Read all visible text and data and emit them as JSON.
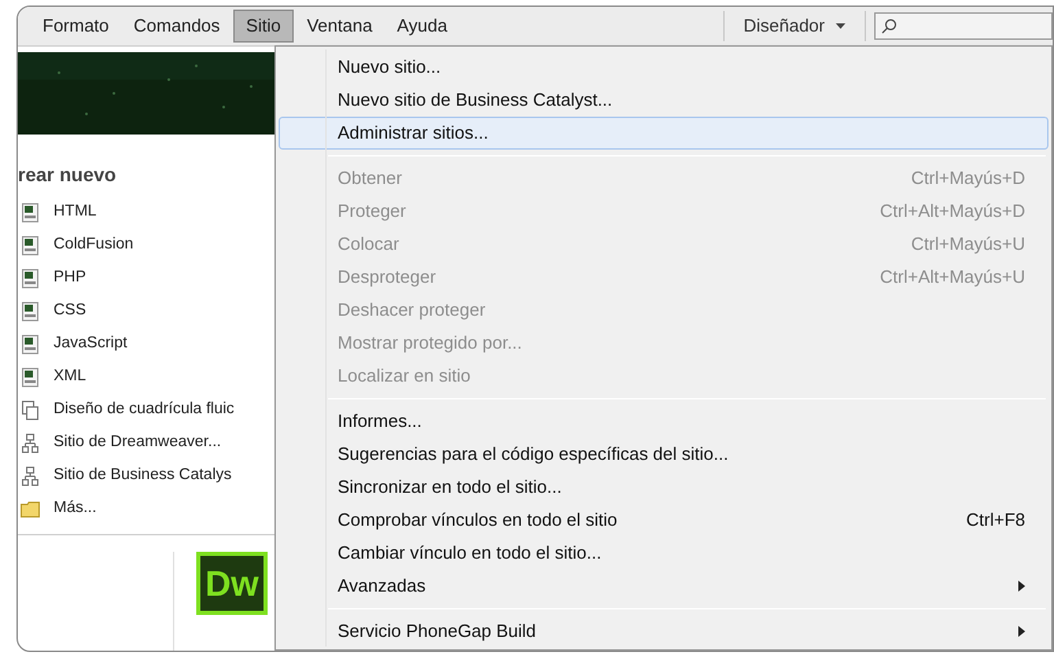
{
  "menubar": {
    "items": [
      {
        "label": "Formato",
        "selected": false
      },
      {
        "label": "Comandos",
        "selected": false
      },
      {
        "label": "Sitio",
        "selected": true
      },
      {
        "label": "Ventana",
        "selected": false
      },
      {
        "label": "Ayuda",
        "selected": false
      }
    ],
    "workspace": "Diseñador"
  },
  "start_panel": {
    "heading": "rear nuevo",
    "items": [
      {
        "label": "HTML",
        "kind": "document"
      },
      {
        "label": "ColdFusion",
        "kind": "document"
      },
      {
        "label": "PHP",
        "kind": "document"
      },
      {
        "label": "CSS",
        "kind": "document"
      },
      {
        "label": "JavaScript",
        "kind": "document"
      },
      {
        "label": "XML",
        "kind": "document"
      },
      {
        "label": "Diseño de cuadrícula fluic",
        "kind": "grid"
      },
      {
        "label": "Sitio de Dreamweaver...",
        "kind": "site"
      },
      {
        "label": "Sitio de Business Catalys",
        "kind": "site"
      },
      {
        "label": "Más...",
        "kind": "folder"
      }
    ],
    "logo": "Dw"
  },
  "site_menu": {
    "groups": [
      [
        {
          "label": "Nuevo sitio...",
          "disabled": false,
          "selected": false
        },
        {
          "label": "Nuevo sitio de Business Catalyst...",
          "disabled": false,
          "selected": false
        },
        {
          "label": "Administrar sitios...",
          "disabled": false,
          "selected": true
        }
      ],
      [
        {
          "label": "Obtener",
          "shortcut": "Ctrl+Mayús+D",
          "disabled": true,
          "selected": false
        },
        {
          "label": "Proteger",
          "shortcut": "Ctrl+Alt+Mayús+D",
          "disabled": true,
          "selected": false
        },
        {
          "label": "Colocar",
          "shortcut": "Ctrl+Mayús+U",
          "disabled": true,
          "selected": false
        },
        {
          "label": "Desproteger",
          "shortcut": "Ctrl+Alt+Mayús+U",
          "disabled": true,
          "selected": false
        },
        {
          "label": "Deshacer proteger",
          "disabled": true,
          "selected": false
        },
        {
          "label": "Mostrar protegido por...",
          "disabled": true,
          "selected": false
        },
        {
          "label": "Localizar en sitio",
          "disabled": true,
          "selected": false
        }
      ],
      [
        {
          "label": "Informes...",
          "disabled": false,
          "selected": false
        },
        {
          "label": "Sugerencias para el código específicas del sitio...",
          "disabled": false,
          "selected": false
        },
        {
          "label": "Sincronizar en todo el sitio...",
          "disabled": false,
          "selected": false
        },
        {
          "label": "Comprobar vínculos en todo el sitio",
          "shortcut": "Ctrl+F8",
          "disabled": false,
          "selected": false
        },
        {
          "label": "Cambiar vínculo en todo el sitio...",
          "disabled": false,
          "selected": false
        },
        {
          "label": "Avanzadas",
          "submenu": true,
          "disabled": false,
          "selected": false
        }
      ],
      [
        {
          "label": "Servicio PhoneGap Build",
          "submenu": true,
          "disabled": false,
          "selected": false
        }
      ]
    ]
  }
}
